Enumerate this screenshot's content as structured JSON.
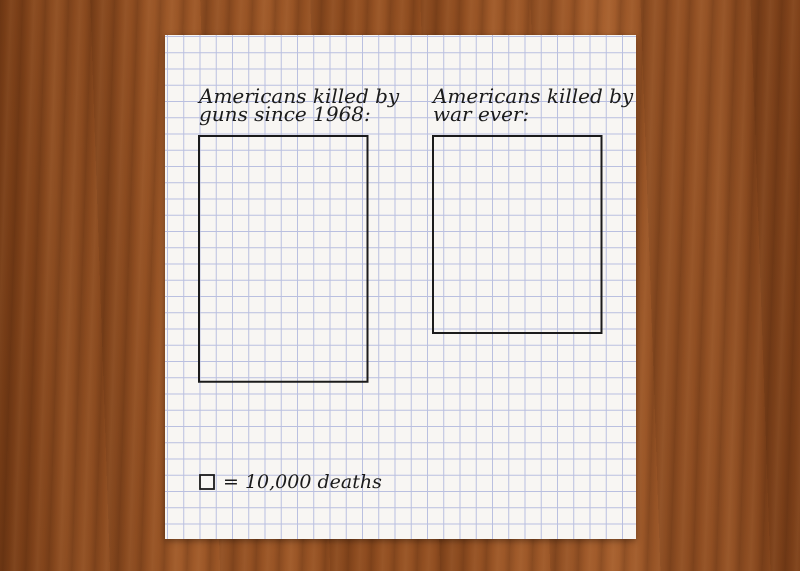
{
  "chart_data": {
    "type": "bar",
    "unit_value": 10000,
    "grid_units": {
      "bar_width_cells": 10
    },
    "bars": [
      {
        "title_line1": "Americans killed by",
        "title_line2": "guns since 1968:",
        "value": 1500000
      },
      {
        "title_line1": "Americans killed by",
        "title_line2": "war ever:",
        "value": 1200000
      }
    ],
    "legend": {
      "text": "= 10,000 deaths"
    }
  },
  "colors": {
    "ink": "#1b1b1b",
    "grid": "#b9bfe0",
    "paper": "#f8f6f3"
  }
}
